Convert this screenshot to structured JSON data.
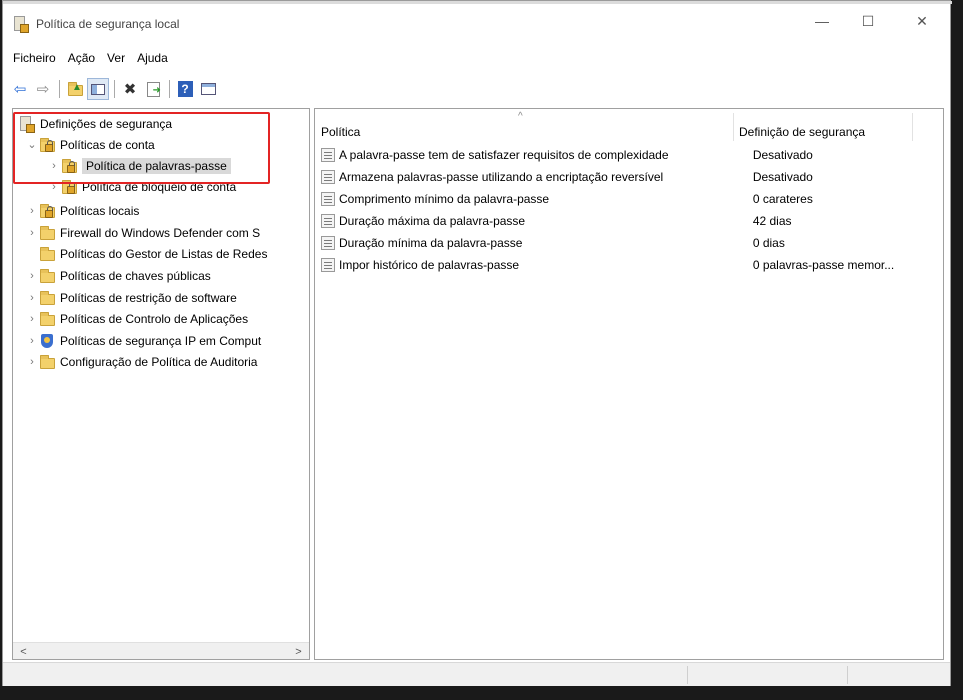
{
  "window": {
    "title": "Política de segurança local"
  },
  "controls": {
    "minimize": "—",
    "maximize": "☐",
    "close": "✕"
  },
  "menu": [
    "Ficheiro",
    "Ação",
    "Ver",
    "Ajuda"
  ],
  "toolbar": {
    "icons": [
      "back-arrow-icon",
      "forward-arrow-icon",
      "up-folder-icon",
      "show-hide-tree-icon",
      "delete-icon",
      "export-list-icon",
      "help-icon",
      "properties-icon"
    ],
    "back": "⇦",
    "forward": "⇨",
    "delete": "✖",
    "help": "?"
  },
  "tree": {
    "root": "Definições de segurança",
    "items": [
      {
        "label": "Políticas de conta",
        "expanded": true,
        "chevron": "⌄"
      },
      {
        "label": "Política de palavras-passe",
        "selected": true,
        "chevron": "›"
      },
      {
        "label": "Política de bloqueio de conta",
        "chevron": "›"
      },
      {
        "label": "Políticas locais",
        "chevron": "›"
      },
      {
        "label": "Firewall do Windows Defender com S",
        "chevron": "›"
      },
      {
        "label": "Políticas do Gestor de Listas de Redes",
        "chevron": ""
      },
      {
        "label": "Políticas de chaves públicas",
        "chevron": "›"
      },
      {
        "label": "Políticas de restrição de software",
        "chevron": "›"
      },
      {
        "label": "Políticas de Controlo de Aplicações",
        "chevron": "›"
      },
      {
        "label": "Políticas de segurança IP em Comput",
        "chevron": "›"
      },
      {
        "label": "Configuração de Política de Auditoria",
        "chevron": "›"
      }
    ],
    "scroll_left": "<",
    "scroll_right": ">"
  },
  "list": {
    "columns": [
      "Política",
      "Definição de segurança"
    ],
    "sort_indicator": "^",
    "rows": [
      {
        "policy": "A palavra-passe tem de satisfazer requisitos de complexidade",
        "setting": "Desativado"
      },
      {
        "policy": "Armazena palavras-passe utilizando a encriptação reversível",
        "setting": "Desativado"
      },
      {
        "policy": "Comprimento mínimo da palavra-passe",
        "setting": "0 carateres"
      },
      {
        "policy": "Duração máxima da palavra-passe",
        "setting": "42 dias"
      },
      {
        "policy": "Duração mínima da palavra-passe",
        "setting": "0 dias"
      },
      {
        "policy": "Impor histórico de palavras-passe",
        "setting": "0 palavras-passe memor..."
      }
    ]
  },
  "colors": {
    "highlight_box": "#e32424",
    "selection": "#d9d9d9",
    "folder": "#f3d16b"
  }
}
